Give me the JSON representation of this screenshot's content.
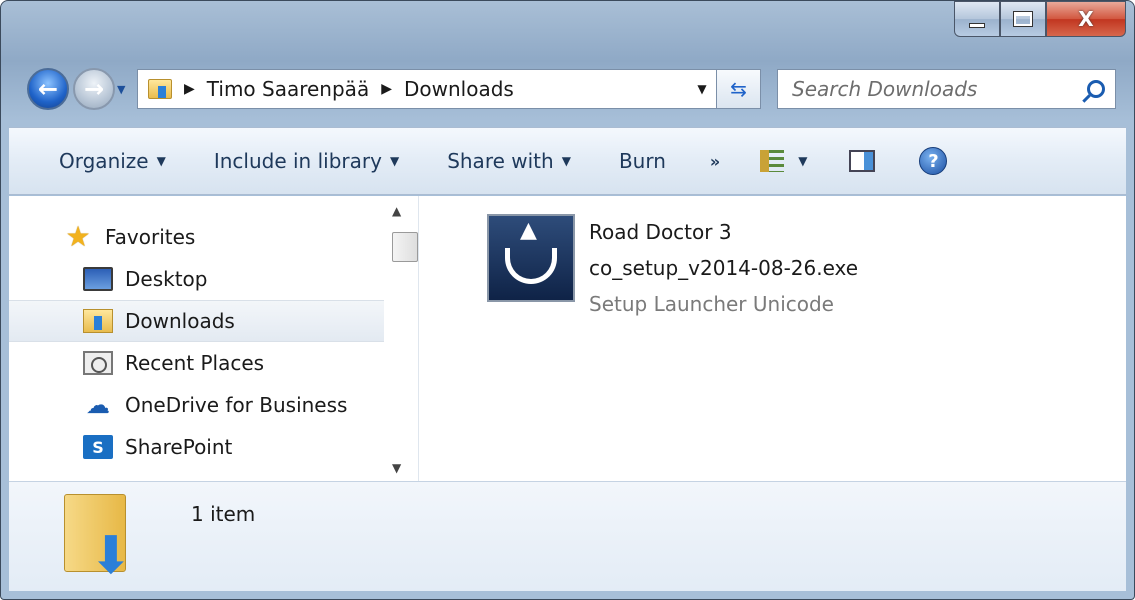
{
  "window": {
    "caption_close": "X"
  },
  "nav": {
    "breadcrumb": [
      "Timo Saarenpää",
      "Downloads"
    ],
    "search_placeholder": "Search Downloads"
  },
  "toolbar": {
    "organize": "Organize",
    "include_in_library": "Include in library",
    "share_with": "Share with",
    "burn": "Burn",
    "more": "»"
  },
  "sidebar": {
    "items": [
      {
        "label": "Favorites",
        "icon": "star-icon",
        "selected": false
      },
      {
        "label": "Desktop",
        "icon": "desktop-icon",
        "selected": false
      },
      {
        "label": "Downloads",
        "icon": "downloads-folder-icon",
        "selected": true
      },
      {
        "label": "Recent Places",
        "icon": "recent-places-icon",
        "selected": false
      },
      {
        "label": "OneDrive for Business",
        "icon": "onedrive-icon",
        "selected": false
      },
      {
        "label": "SharePoint",
        "icon": "sharepoint-icon",
        "selected": false
      }
    ]
  },
  "files": [
    {
      "name_line1": "Road Doctor 3",
      "name_line2": "co_setup_v2014-08-26.exe",
      "type": "Setup Launcher Unicode",
      "icon": "setup-launcher-icon"
    }
  ],
  "details": {
    "item_count": "1 item"
  },
  "colors": {
    "accent": "#1f63c9",
    "toolbar_text": "#1e395b",
    "file_type_text": "#7a7a7a"
  }
}
